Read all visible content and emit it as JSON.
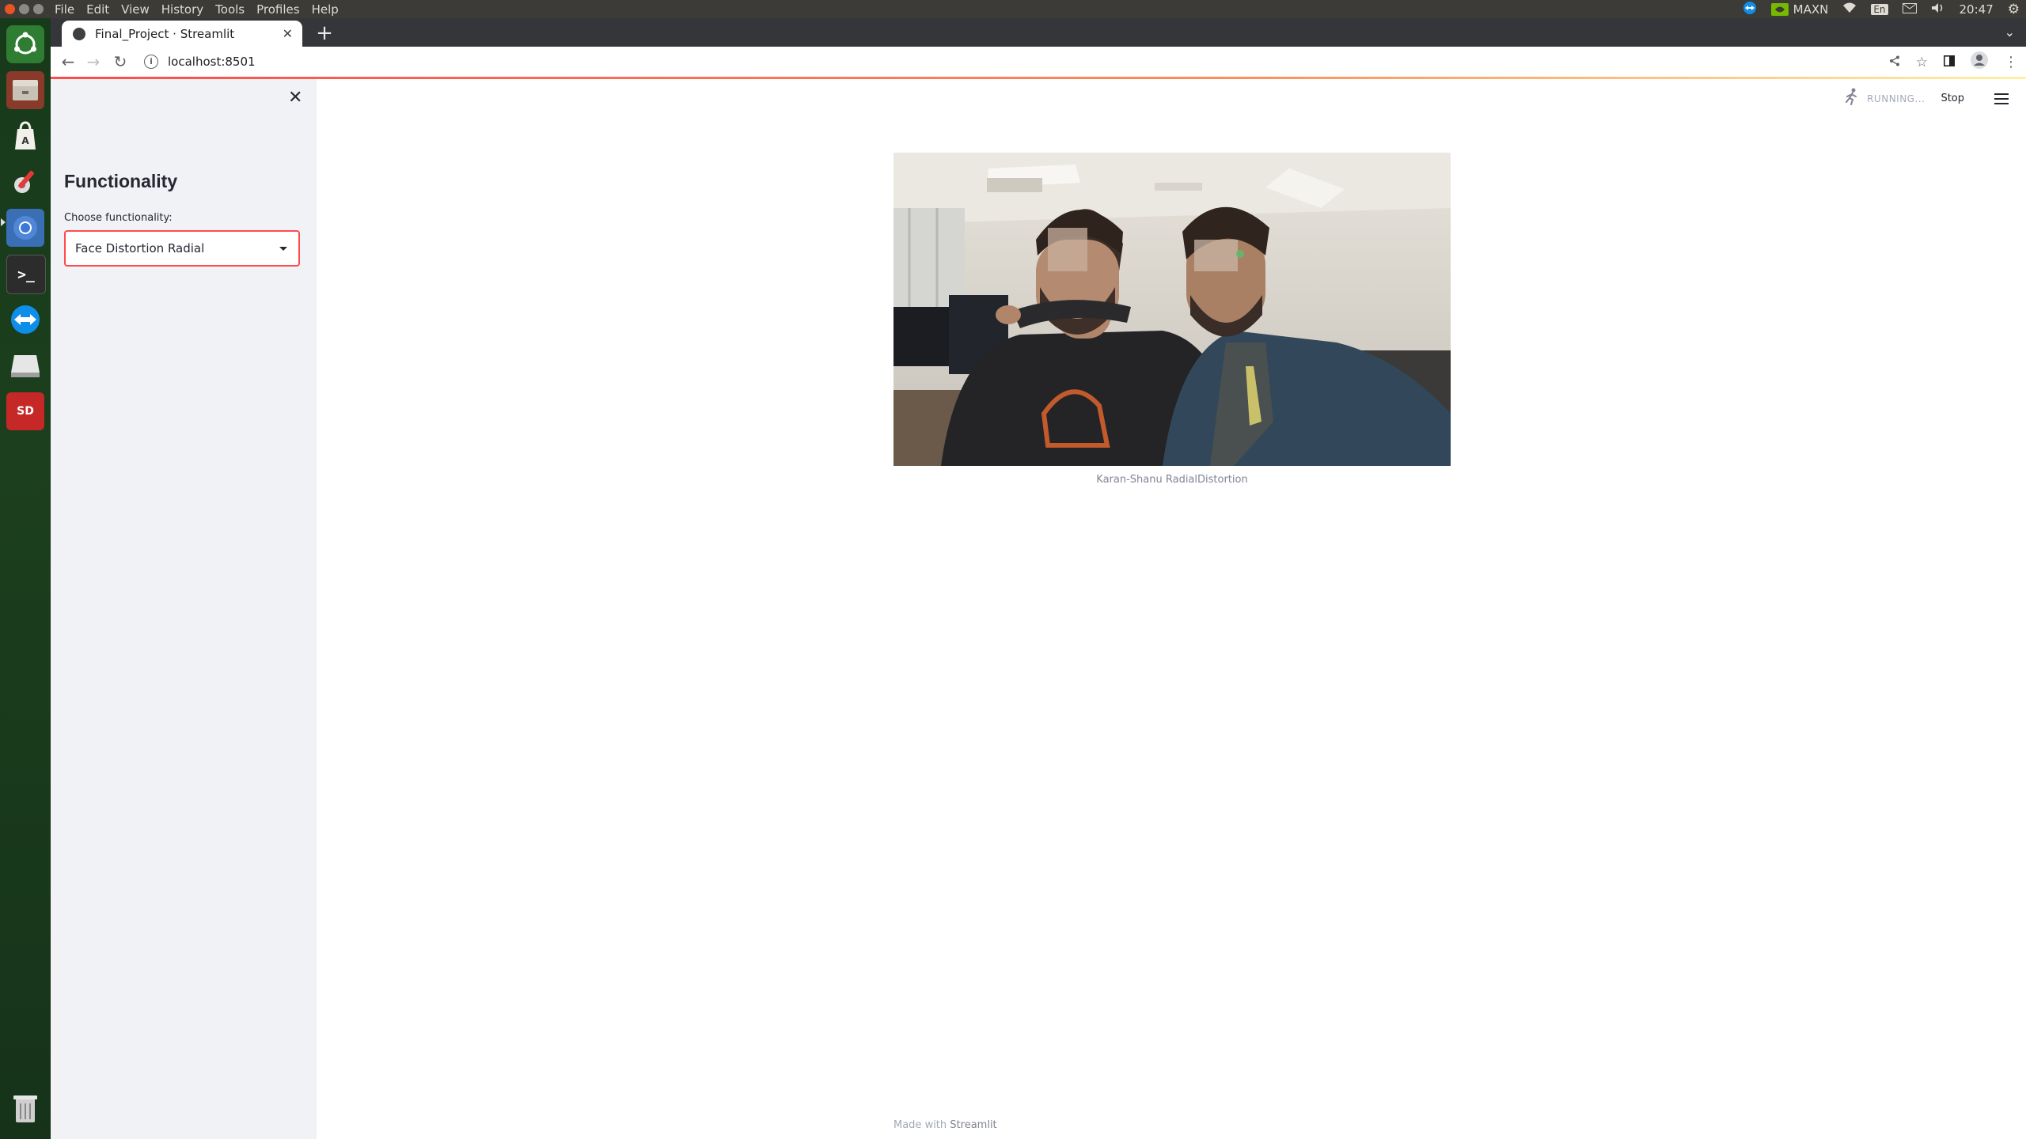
{
  "os": {
    "menu": [
      "File",
      "Edit",
      "View",
      "History",
      "Tools",
      "Profiles",
      "Help"
    ],
    "tray": {
      "gpu_mode": "MAXN",
      "keyboard": "En",
      "clock": "20:47"
    },
    "launcher_icons": [
      "ubuntu-logo-icon",
      "files-icon",
      "software-center-icon",
      "settings-icon",
      "chromium-icon",
      "terminal-icon",
      "teamviewer-icon",
      "drive-icon",
      "sdk-manager-icon",
      "trash-icon"
    ]
  },
  "browser": {
    "tab_title": "Final_Project · Streamlit",
    "url": "localhost:8501"
  },
  "sidebar": {
    "title": "Functionality",
    "select_label": "Choose functionality:",
    "select_value": "Face Distortion Radial"
  },
  "status": {
    "running": "RUNNING...",
    "stop": "Stop"
  },
  "main": {
    "image_caption": "Karan-Shanu RadialDistortion",
    "footer_prefix": "Made with",
    "footer_brand": "Streamlit"
  },
  "colors": {
    "accent": "#ff4b4b",
    "sidebar_bg": "#f0f2f6",
    "launcher_bg": "#1c3f1d",
    "tabstrip_bg": "#35363a"
  }
}
